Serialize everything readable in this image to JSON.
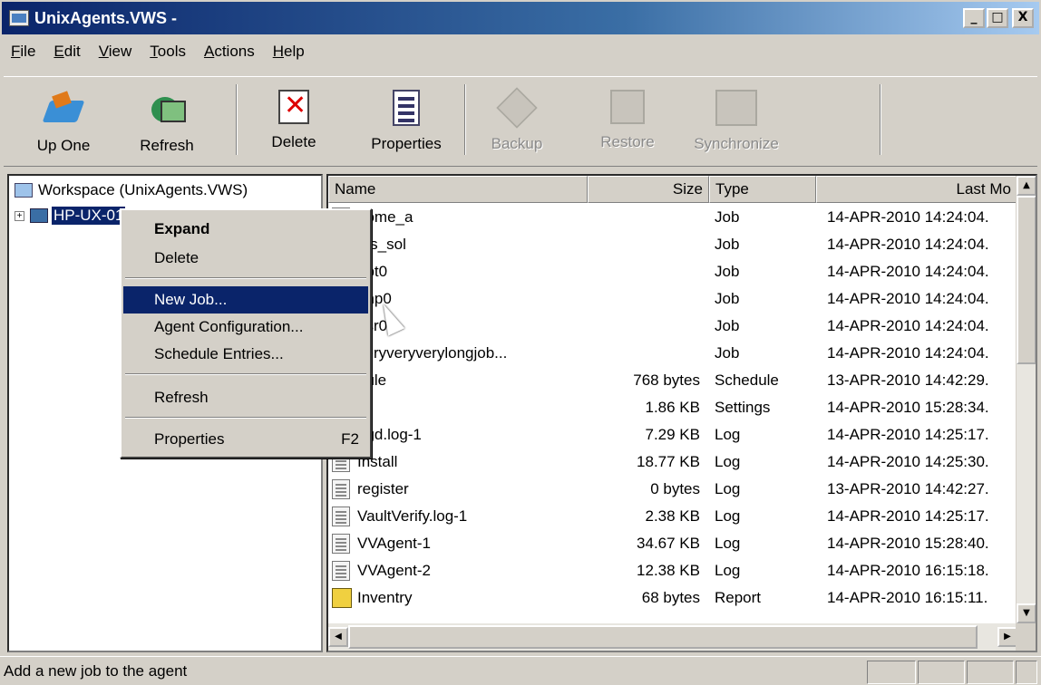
{
  "window": {
    "title": "UnixAgents.VWS -",
    "controls": [
      "_",
      "□",
      "X"
    ]
  },
  "menu": [
    "File",
    "Edit",
    "View",
    "Tools",
    "Actions",
    "Help"
  ],
  "toolbar": {
    "up_one": "Up One",
    "refresh": "Refresh",
    "delete": "Delete",
    "properties": "Properties",
    "backup": "Backup",
    "restore": "Restore",
    "synchronize": "Synchronize"
  },
  "tree": {
    "root": "Workspace (UnixAgents.VWS)",
    "child": "HP-UX-01",
    "expand_glyph": "+"
  },
  "list": {
    "columns": [
      "Name",
      "Size",
      "Type",
      "Last Mo"
    ],
    "rows": [
      {
        "name": "home_a",
        "size": "",
        "type": "Job",
        "modified": "14-APR-2010 14:24:04."
      },
      {
        "name": "nfs_sol",
        "size": "",
        "type": "Job",
        "modified": "14-APR-2010 14:24:04."
      },
      {
        "name": "opt0",
        "size": "",
        "type": "Job",
        "modified": "14-APR-2010 14:24:04."
      },
      {
        "name": "tmp0",
        "size": "",
        "type": "Job",
        "modified": "14-APR-2010 14:24:04."
      },
      {
        "name": "usr0",
        "size": "",
        "type": "Job",
        "modified": "14-APR-2010 14:24:04."
      },
      {
        "name": "veryveryverylongjob...",
        "size": "",
        "type": "Job",
        "modified": "14-APR-2010 14:24:04."
      },
      {
        "name": "dule",
        "size": "768 bytes",
        "type": "Schedule",
        "modified": "13-APR-2010 14:42:29."
      },
      {
        "name": "l",
        "size": "1.86 KB",
        "type": "Settings",
        "modified": "14-APR-2010 15:28:34."
      },
      {
        "name": "ogd.log-1",
        "size": "7.29 KB",
        "type": "Log",
        "modified": "14-APR-2010 14:25:17."
      },
      {
        "name": "Install",
        "size": "18.77 KB",
        "type": "Log",
        "modified": "14-APR-2010 14:25:30."
      },
      {
        "name": "register",
        "size": "0 bytes",
        "type": "Log",
        "modified": "13-APR-2010 14:42:27."
      },
      {
        "name": "VaultVerify.log-1",
        "size": "2.38 KB",
        "type": "Log",
        "modified": "14-APR-2010 14:25:17."
      },
      {
        "name": "VVAgent-1",
        "size": "34.67 KB",
        "type": "Log",
        "modified": "14-APR-2010 15:28:40."
      },
      {
        "name": "VVAgent-2",
        "size": "12.38 KB",
        "type": "Log",
        "modified": "14-APR-2010 16:15:18."
      },
      {
        "name": "Inventry",
        "size": "68 bytes",
        "type": "Report",
        "modified": "14-APR-2010 16:15:11."
      }
    ]
  },
  "context_menu": {
    "expand": "Expand",
    "delete": "Delete",
    "new_job": "New Job...",
    "agent_config": "Agent Configuration...",
    "schedule_entries": "Schedule Entries...",
    "refresh": "Refresh",
    "properties": "Properties",
    "properties_key": "F2"
  },
  "status": {
    "text": "Add a new job to the agent"
  },
  "colors": {
    "selection": "#0a246a",
    "chrome": "#d4d0c8",
    "title_start": "#0a246a"
  }
}
